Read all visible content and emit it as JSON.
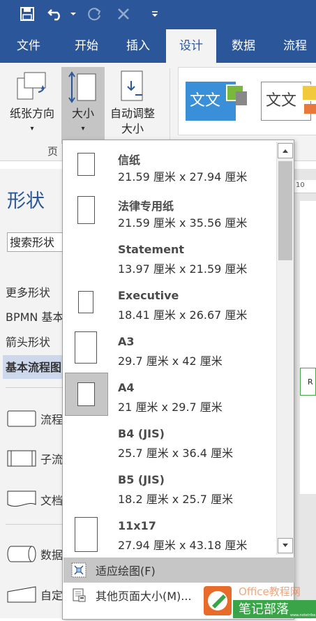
{
  "qat": {
    "save_icon": "save-icon",
    "undo_icon": "undo-icon",
    "redo_icon": "redo-icon",
    "cancel_icon": "close-icon",
    "customize_icon": "chevron-down-icon"
  },
  "tabs": [
    {
      "label": "文件"
    },
    {
      "label": "开始"
    },
    {
      "label": "插入"
    },
    {
      "label": "设计"
    },
    {
      "label": "数据"
    },
    {
      "label": "流程"
    }
  ],
  "ribbon": {
    "orientation_label": "纸张方向",
    "size_label": "大小",
    "autofit_label_1": "自动调整",
    "autofit_label_2": "大小",
    "group_label": "页",
    "theme1_text": "文文",
    "theme2_text": "文文"
  },
  "shapes_pane": {
    "title": "形状",
    "search_placeholder": "搜索形状",
    "stencils": [
      "更多形状",
      "BPMN 基本",
      "箭头形状",
      "基本流程图"
    ],
    "shapes": [
      "流程",
      "子流",
      "文档",
      "数据",
      "自定"
    ]
  },
  "canvas": {
    "ruler_label": "10",
    "shape_text": "R"
  },
  "size_menu": {
    "items": [
      {
        "name": "信纸",
        "dims": "21.59 厘米 x 27.94 厘米"
      },
      {
        "name": "法律专用纸",
        "dims": "21.59 厘米 x 35.56 厘米"
      },
      {
        "name": "Statement",
        "dims": "13.97 厘米 x 21.59 厘米"
      },
      {
        "name": "Executive",
        "dims": "18.41 厘米 x 26.67 厘米"
      },
      {
        "name": "A3",
        "dims": "29.7 厘米 x 42 厘米"
      },
      {
        "name": "A4",
        "dims": "21 厘米 x 29.7 厘米"
      },
      {
        "name": "B4 (JIS)",
        "dims": "25.7 厘米 x 36.4 厘米"
      },
      {
        "name": "B5 (JIS)",
        "dims": "18.2 厘米 x 25.7 厘米"
      },
      {
        "name": "11x17",
        "dims": "27.94 厘米 x 43.18 厘米"
      }
    ],
    "selected": "A4",
    "fit_to_drawing": "适应绘图(F)",
    "more_sizes": "其他页面大小(M)..."
  },
  "watermark": {
    "line1": "Office教程网",
    "line2": "笔记部落",
    "line3": "www.notetribe.com"
  },
  "colors": {
    "brand": "#2b579a",
    "ribbon": "#f3f3f3",
    "hover": "#c6c6c6"
  }
}
